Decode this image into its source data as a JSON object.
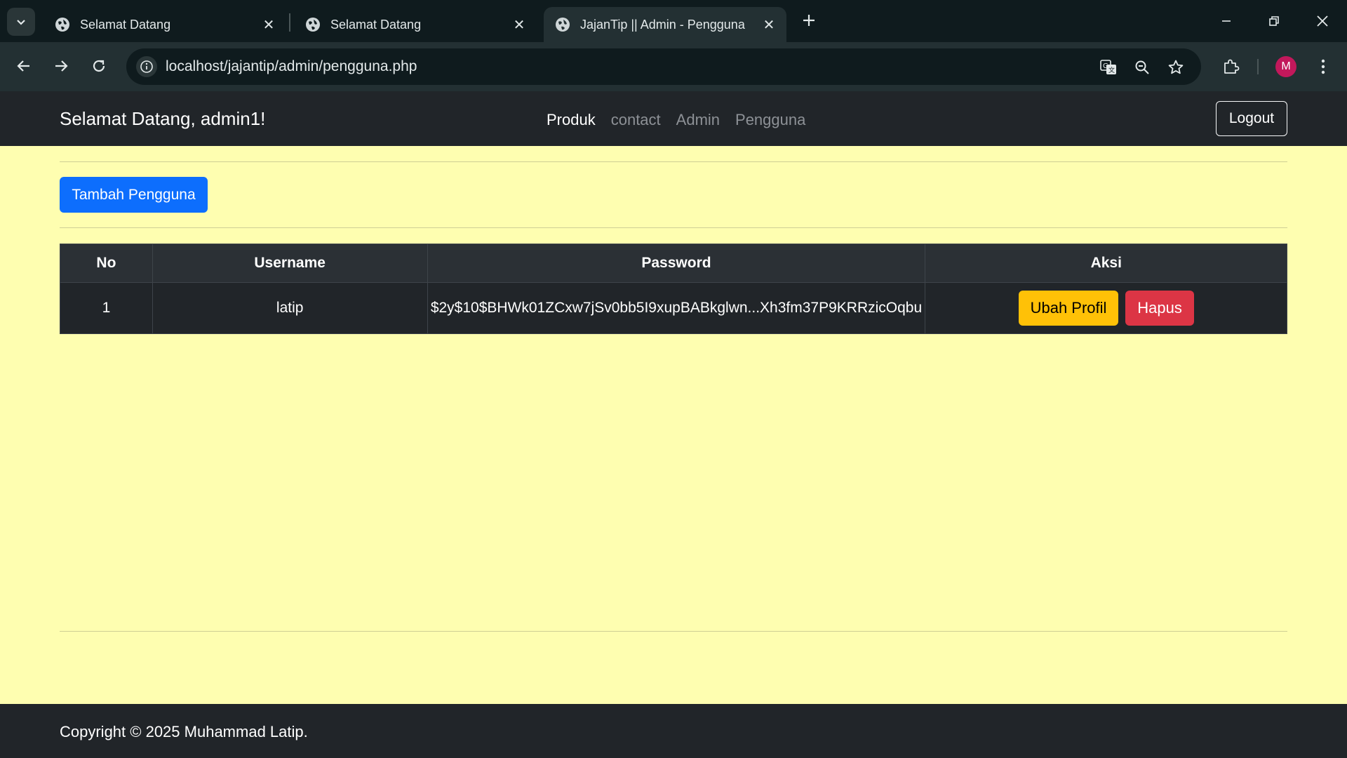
{
  "browser": {
    "tabs": [
      {
        "title": "Selamat Datang"
      },
      {
        "title": "Selamat Datang"
      },
      {
        "title": "JajanTip || Admin - Pengguna"
      }
    ],
    "url": "localhost/jajantip/admin/pengguna.php",
    "profile_initial": "M"
  },
  "navbar": {
    "brand": "Selamat Datang, admin1!",
    "links": [
      "Produk",
      "contact",
      "Admin",
      "Pengguna"
    ],
    "logout_label": "Logout"
  },
  "main": {
    "add_button_label": "Tambah Pengguna",
    "table": {
      "headers": [
        "No",
        "Username",
        "Password",
        "Aksi"
      ],
      "rows": [
        {
          "no": "1",
          "username": "latip",
          "password": "$2y$10$BHWk01ZCxw7jSv0bb5I9xupBABkglwn...Xh3fm37P9KRRzicOqbu",
          "edit_label": "Ubah Profil",
          "delete_label": "Hapus"
        }
      ]
    }
  },
  "footer": {
    "copyright": "Copyright © 2025 Muhammad Latip."
  },
  "colors": {
    "page_bg": "#fefeb0",
    "navbar_bg": "#212529",
    "primary": "#0d6efd",
    "warning": "#ffc107",
    "danger": "#dc3545",
    "avatar": "#c2185b"
  }
}
